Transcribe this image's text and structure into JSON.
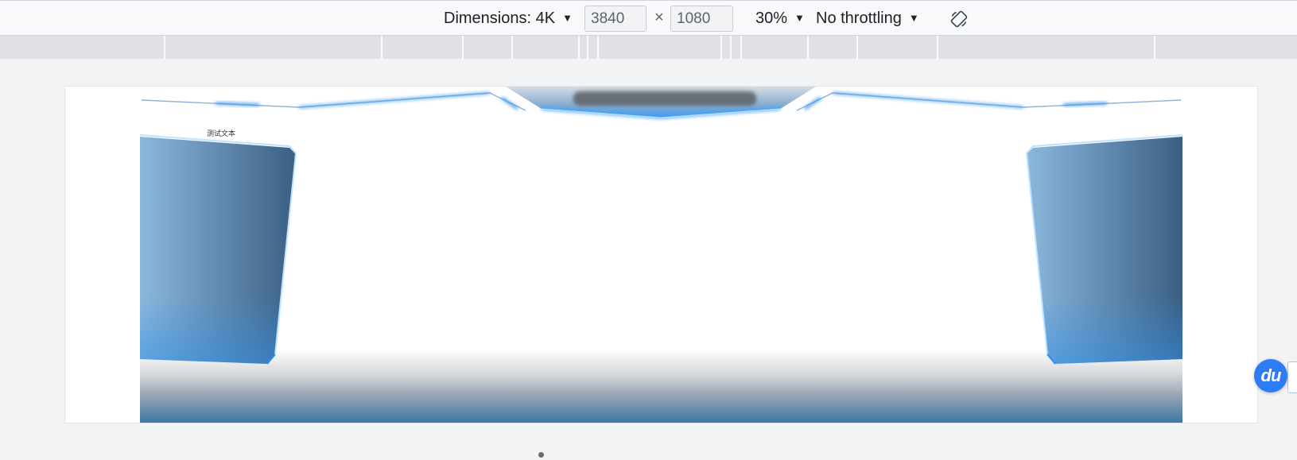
{
  "toolbar": {
    "dimensions_label": "Dimensions: 4K",
    "width_value": "3840",
    "height_value": "1080",
    "times_symbol": "×",
    "zoom_label": "30%",
    "throttling_label": "No throttling",
    "caret": "▼",
    "rotate_icon": "rotate-icon"
  },
  "viewport": {
    "test_text": "测试文本",
    "colors": {
      "panel_light": "#8cb8de",
      "panel_dark": "#3a5f82",
      "glow": "#2f8fe8",
      "floor_bottom": "#3b77a3"
    }
  },
  "floating": {
    "baidu_label": "du"
  }
}
